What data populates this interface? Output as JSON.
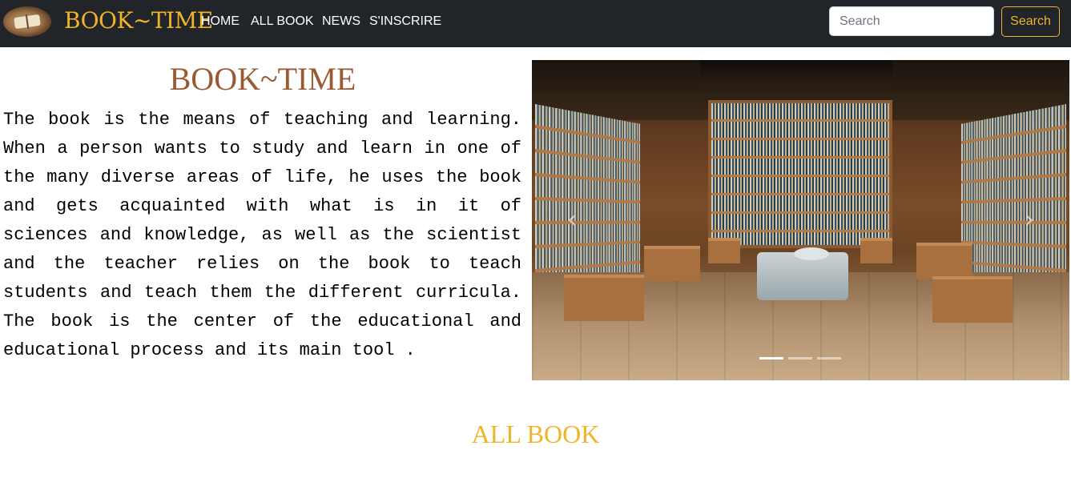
{
  "navbar": {
    "brand": "BOOK~TIME",
    "links": [
      "HOME",
      "ALL BOOK",
      "NEWS",
      "S'INSCRIRE"
    ],
    "search_placeholder": "Search",
    "search_button": "Search",
    "colors": {
      "background": "#212529",
      "accent": "#f0b429"
    }
  },
  "hero": {
    "title": "BOOK~TIME",
    "text": "The book is the means of teaching and learning. When a person wants to study and learn in one of the many diverse areas of life, he uses the book and gets acquainted with what is in it of sciences and knowledge, as well as the scientist and the teacher relies on the book to teach students and teach them the different curricula. The book is the center of the educational and educational process and its main tool .",
    "title_color": "#9a5a31"
  },
  "carousel": {
    "image": "library-interior",
    "prev_icon": "chevron-left-icon",
    "next_icon": "chevron-right-icon",
    "prev_glyph": "‹",
    "next_glyph": "›",
    "slide_count": 3,
    "active_slide": 1
  },
  "section": {
    "title": "ALL BOOK"
  }
}
